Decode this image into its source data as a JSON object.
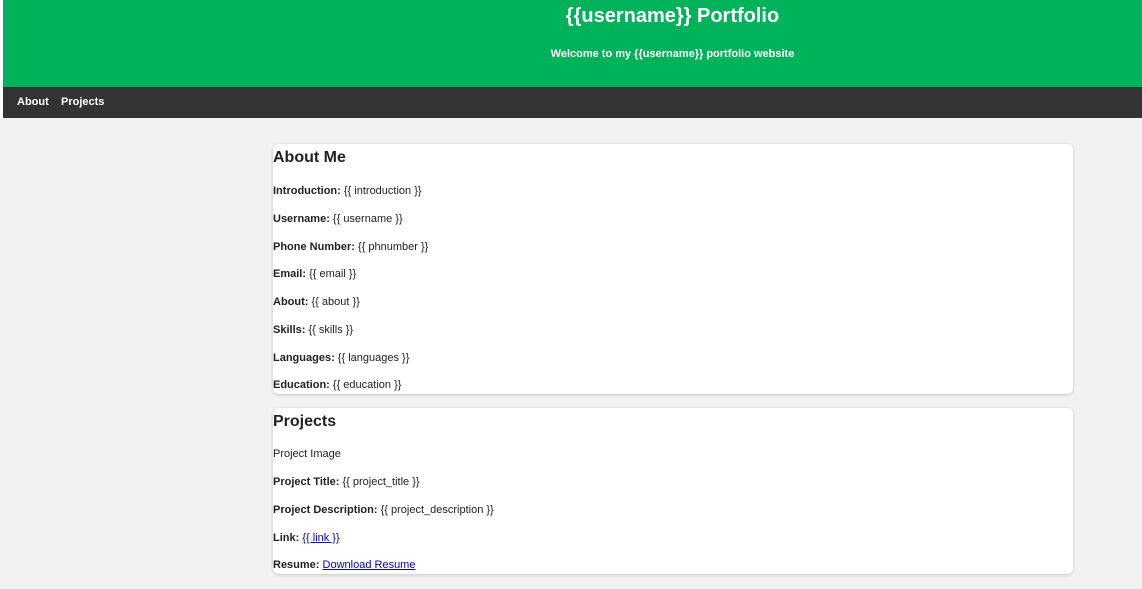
{
  "header": {
    "title": "{{username}} Portfolio",
    "subtitle": "Welcome to my {{username}} portfolio website",
    "bg_color": "#00b259"
  },
  "nav": {
    "bg_color": "#333333",
    "items": [
      {
        "label": "About"
      },
      {
        "label": "Projects"
      }
    ]
  },
  "about": {
    "heading": "About Me",
    "fields": [
      {
        "label": "Introduction:",
        "value": " {{ introduction }}"
      },
      {
        "label": "Username:",
        "value": " {{ username }}"
      },
      {
        "label": "Phone Number:",
        "value": " {{ phnumber }}"
      },
      {
        "label": "Email:",
        "value": " {{ email }}"
      },
      {
        "label": "About:",
        "value": " {{ about }}"
      },
      {
        "label": "Skills:",
        "value": " {{ skills }}"
      },
      {
        "label": "Languages:",
        "value": " {{ languages }}"
      },
      {
        "label": "Education:",
        "value": " {{ education }}"
      }
    ]
  },
  "projects": {
    "heading": "Projects",
    "image_alt": "Project Image",
    "title_label": "Project Title:",
    "title_value": " {{ project_title }}",
    "description_label": "Project Description:",
    "description_value": " {{ project_description }}",
    "link_label": "Link:",
    "link_text": "{{ link }}",
    "resume_label": "Resume:",
    "resume_link_text": "Download Resume"
  }
}
